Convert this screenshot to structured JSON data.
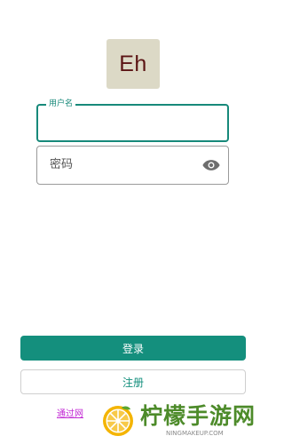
{
  "logo": {
    "text": "Eh",
    "bg_color": "#dcd9c6",
    "text_color": "#5b1414"
  },
  "form": {
    "username_label": "用户名",
    "password_placeholder": "密码",
    "accent_color": "#17897a"
  },
  "buttons": {
    "login": "登录",
    "register": "注册"
  },
  "links": {
    "web_login": "通过网"
  },
  "watermark": {
    "title": "柠檬手游网",
    "url": "NINGMAKEUP.COM"
  },
  "icons": [
    "eye-icon",
    "lemon-logo-icon"
  ]
}
